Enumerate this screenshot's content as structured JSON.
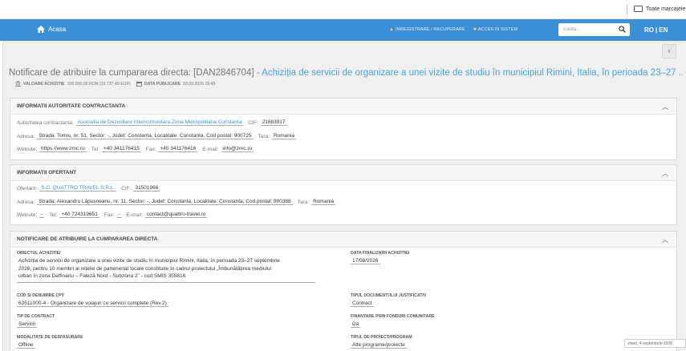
{
  "bookmarks": {
    "folder_label": "Toate marcajele"
  },
  "navbar": {
    "home_label": "Acasa",
    "register_label": "INREGISTRARE / RECUPERARE",
    "access_label": "ACCES IN SISTEM",
    "search_placeholder": "Cauta...",
    "lang_ro": "RO",
    "lang_sep": "|",
    "lang_en": "EN"
  },
  "notice": {
    "title_prefix": "Notificare de atribuire la cumpararea directa: [DAN2846704]",
    "title_sep": " - ",
    "title_subject": "Achiziția de servicii de organizare a unei vizite de studiu în municipiul Rimini, Italia, în perioada 23–27 ...",
    "value_label": "VALOARE ACHIZITIE",
    "value_text": "100.000,00 RON (19.737,49 EUR)",
    "date_label": "DATA PUBLICARE",
    "date_text": "03.09.2026 15:45"
  },
  "authority": {
    "section_title": "INFORMATII AUTORITATE CONTRACTANTA",
    "authority_label": "Autoritatea contractanta:",
    "authority_name": "Asociatia de Dezvoltare Intercomunitara Zona Metropolitana Constanta",
    "cif_label": "CIF:",
    "cif": "21683917",
    "address_label": "Adresa:",
    "address": "Strada: Tomis, nr. 51, Sector: -, Judet: Constanta, Localitate: Constanta, Cod postal: 900725",
    "country_label": "Tara:",
    "country": "Romania",
    "website_label": "Website:",
    "website": "https://www.zmc.ro",
    "tel_label": "Tel:",
    "tel": "+40 341176415",
    "fax_label": "Fax:",
    "fax": "+40 341176416",
    "email_label": "E-mail:",
    "email": "info@zmc.ro"
  },
  "bidder": {
    "section_title": "INFORMATII OFERTANT",
    "bidder_label": "Ofertant:",
    "bidder_name": "S.C. QUATTRO TRAVEL S.R.L.",
    "cif_label": "CIF:",
    "cif": "31501966",
    "address_label": "Adresa:",
    "address": "Strada: Alexandru Lăpușneanu, nr. 11, Sector: -, Judet: Constanta, Localitate: Constanta, Cod postal: 900388",
    "country_label": "Tara:",
    "country": "Romania",
    "website_label": "Website:",
    "website": "-",
    "tel_label": "Tel:",
    "tel": "+40 724319651",
    "fax_label": "Fax:",
    "fax": "-",
    "email_label": "E-mail:",
    "email": "contact@quattro-travel.ro"
  },
  "award": {
    "section_title": "NOTIFICARE DE ATRIBUIRE LA CUMPARAREA DIRECTA",
    "object_label": "OBIECTUL ACHIZITIEI",
    "object_line1": "Achiziția de servicii de organizare a unei vizite de studiu în municipiul Rimini, Italia, în perioada 23–27 septembrie",
    "object_line2": "2026, pentru 10 membri ai rețelei de parteneriat locale constituite în cadrul proiectului „Îmbunătățirea mediului",
    "object_line3": "urban în zona Delfinariu – Faleză Nord - Subzona 2\" - cod SMIS 355816",
    "finalize_label": "DATA FINALIZARII ACHIZITIEI",
    "finalize_date": "17/08/2026",
    "cpv_label": "COD SI DENUMIRE CPV",
    "cpv": "63511000-4 - Organizare de voiajuri cu servicii complete (Rev.2)",
    "doc_type_label": "TIPUL DOCUMENTULUI JUSTIFICATIV",
    "doc_type": "Contract",
    "contract_type_label": "TIP DE CONTRACT",
    "contract_type": "Servicii",
    "eu_funds_label": "FINANTARE PRIN FONDURI COMUNITARE",
    "eu_funds": "Da",
    "mode_label": "MODALITATE DE DESFASURARE",
    "mode": "Offline",
    "program_label": "TIPUL DE PROIECT/PROGRAM",
    "program": "Alte programe/proiecte"
  },
  "system": {
    "date_badge": "vineri, 4 septembrie 2026"
  },
  "colors": {
    "navbar": "#3b8fd6",
    "link": "#3b8fd6",
    "title_gray": "#777777"
  }
}
